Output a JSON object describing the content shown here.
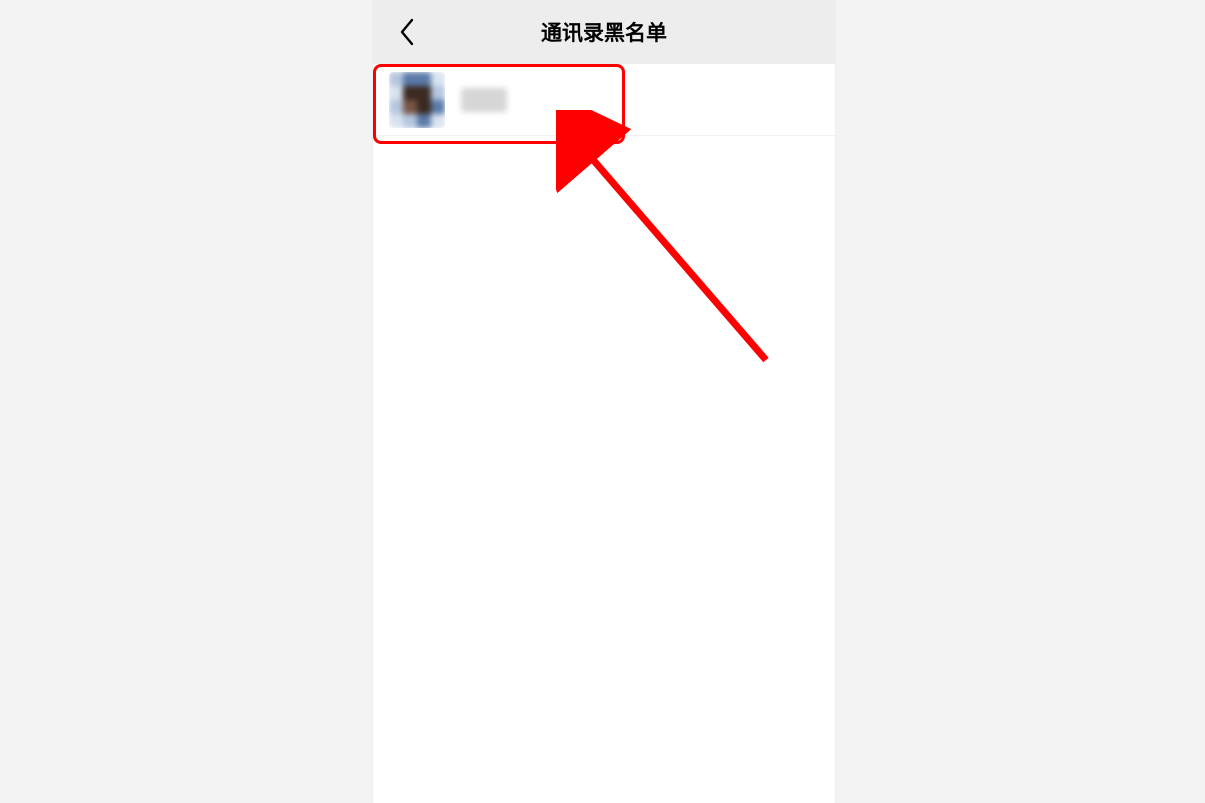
{
  "header": {
    "title": "通讯录黑名单",
    "back_icon": "chevron-left"
  },
  "list": {
    "items": [
      {
        "name": "",
        "avatar": "blurred"
      }
    ]
  },
  "annotation": {
    "highlight": "contact-row",
    "arrow": true
  }
}
